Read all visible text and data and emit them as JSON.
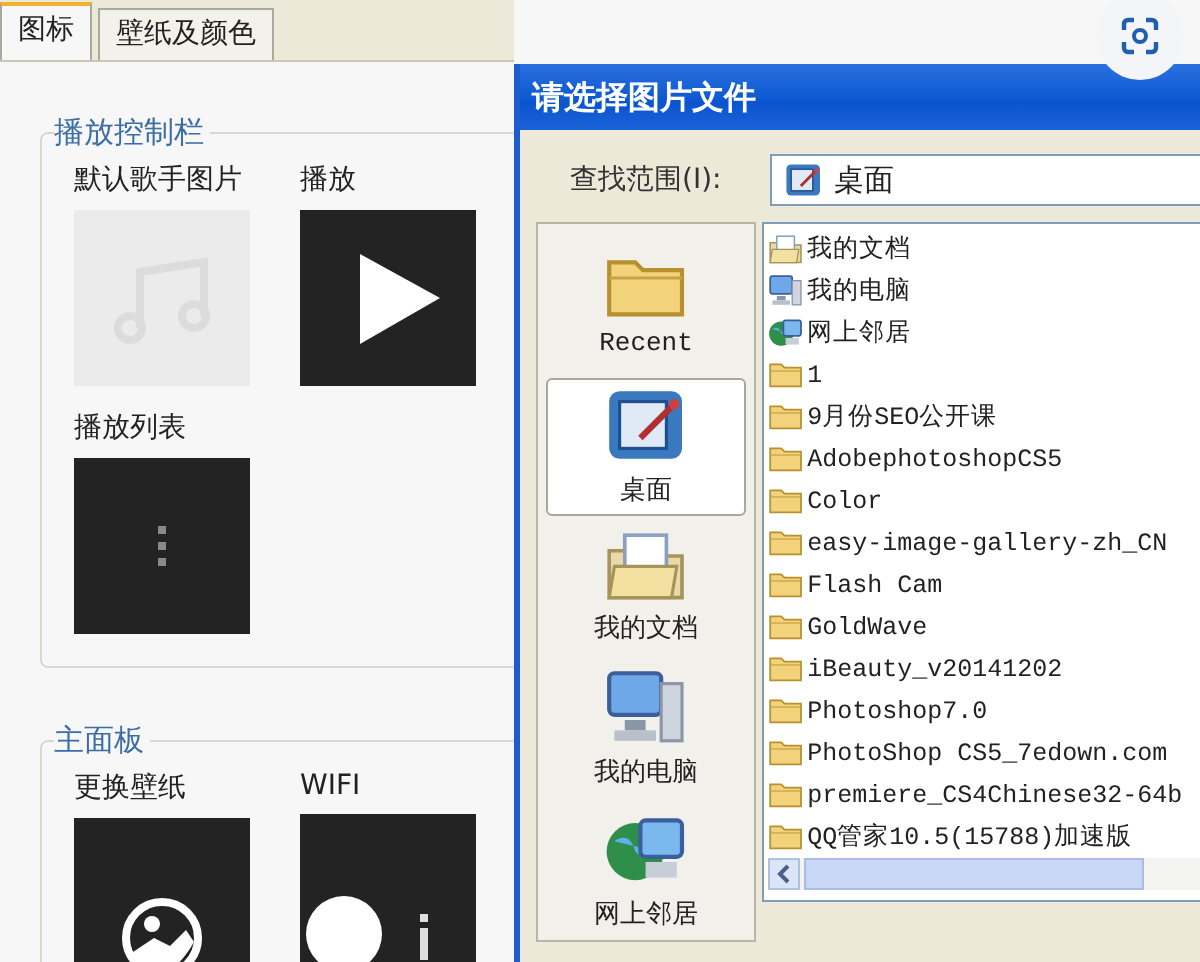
{
  "tabs": [
    {
      "label": "图标",
      "selected": true
    },
    {
      "label": "壁纸及颜色",
      "selected": false
    }
  ],
  "groups": [
    {
      "title": "播放控制栏",
      "tiles": [
        {
          "label": "默认歌手图片",
          "kind": "music"
        },
        {
          "label": "播放",
          "kind": "play"
        },
        {
          "label": "播放列表",
          "kind": "list"
        }
      ]
    },
    {
      "title": "主面板",
      "tiles": [
        {
          "label": "更换壁纸",
          "kind": "wallpaper"
        },
        {
          "label": "WIFI",
          "kind": "wifi"
        }
      ]
    }
  ],
  "dialog": {
    "title": "请选择图片文件",
    "look_in": {
      "label": "查找范围(I):",
      "value": "桌面"
    },
    "places": [
      {
        "label": "Recent",
        "kind": "recent",
        "selected": false
      },
      {
        "label": "桌面",
        "kind": "desktop",
        "selected": true
      },
      {
        "label": "我的文档",
        "kind": "documents",
        "selected": false
      },
      {
        "label": "我的电脑",
        "kind": "computer",
        "selected": false
      },
      {
        "label": "网上邻居",
        "kind": "network",
        "selected": false
      }
    ],
    "files": [
      {
        "name": "我的文档",
        "kind": "documents"
      },
      {
        "name": "我的电脑",
        "kind": "computer"
      },
      {
        "name": "网上邻居",
        "kind": "network"
      },
      {
        "name": "1",
        "kind": "folder"
      },
      {
        "name": "9月份SEO公开课",
        "kind": "folder"
      },
      {
        "name": "AdobephotoshopCS5",
        "kind": "folder"
      },
      {
        "name": "Color",
        "kind": "folder"
      },
      {
        "name": "easy-image-gallery-zh_CN",
        "kind": "folder"
      },
      {
        "name": "Flash Cam",
        "kind": "folder"
      },
      {
        "name": "GoldWave",
        "kind": "folder"
      },
      {
        "name": "iBeauty_v20141202",
        "kind": "folder"
      },
      {
        "name": "Photoshop7.0",
        "kind": "folder"
      },
      {
        "name": "PhotoShop CS5_7edown.com",
        "kind": "folder"
      },
      {
        "name": "premiere_CS4Chinese32-64b",
        "kind": "folder"
      },
      {
        "name": "QQ管家10.5(15788)加速版",
        "kind": "folder"
      }
    ]
  }
}
